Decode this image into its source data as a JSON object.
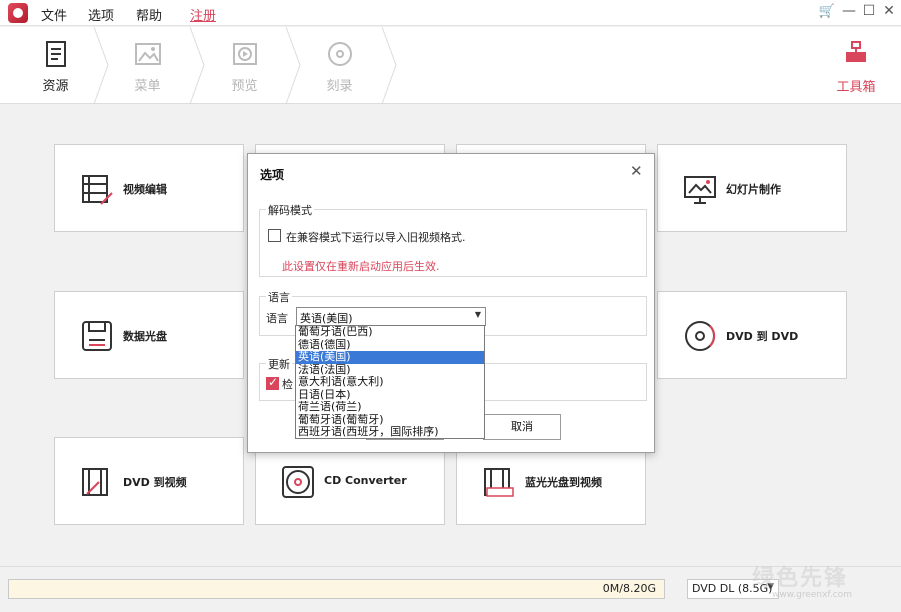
{
  "menubar": {
    "file": "文件",
    "options": "选项",
    "help": "帮助",
    "register": "注册"
  },
  "window_controls": {
    "cart": "🛒",
    "minimize": "—",
    "maximize": "☐",
    "close": "✕"
  },
  "steps": [
    {
      "label": "资源",
      "active": true
    },
    {
      "label": "菜单",
      "active": false
    },
    {
      "label": "预览",
      "active": false
    },
    {
      "label": "刻录",
      "active": false
    }
  ],
  "toolbox": {
    "label": "工具箱"
  },
  "cards": {
    "video_edit": "视频编辑",
    "slideshow": "幻灯片制作",
    "data_disc": "数据光盘",
    "dvd_to_dvd": "DVD 到 DVD",
    "dvd_to_video": "DVD 到视频",
    "cd_converter": "CD Converter",
    "bluray_to_video": "蓝光光盘到视频"
  },
  "status": {
    "capacity": "0M/8.20G",
    "disc_type": "DVD DL (8.5G)"
  },
  "watermark": {
    "text": "绿色先锋",
    "sub": "www.greenxf.com"
  },
  "dialog": {
    "title": "选项",
    "close": "✕",
    "decode_group": "解码模式",
    "compat_label": "在兼容模式下运行以导入旧视频格式.",
    "compat_checked": false,
    "restart_note": "此设置仅在重新启动应用后生效.",
    "lang_group": "语言",
    "lang_label": "语言",
    "lang_selected": "英语(美国)",
    "update_group": "更新",
    "update_label": "检",
    "update_checked": true,
    "ok": "",
    "cancel": "取消"
  },
  "lang_options": [
    "葡萄牙语(巴西)",
    "德语(德国)",
    "英语(美国)",
    "法语(法国)",
    "意大利语(意大利)",
    "日语(日本)",
    "荷兰语(荷兰)",
    "葡萄牙语(葡萄牙)",
    "西班牙语(西班牙，国际排序)"
  ],
  "lang_selected_index": 2,
  "colors": {
    "accent": "#d9455a",
    "selection": "#3a79d6"
  }
}
